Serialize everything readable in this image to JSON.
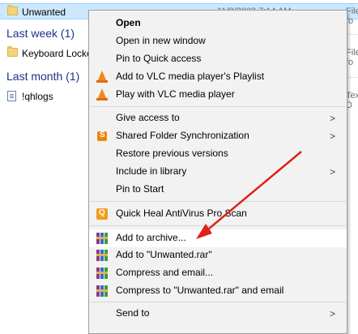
{
  "explorer": {
    "top_row": {
      "name": "Unwanted",
      "date": "11/8/2022 7:14 AM",
      "type": "File fo"
    },
    "groups": [
      {
        "label": "Last week (1)",
        "items": [
          {
            "name": "Keyboard Locke",
            "type": "File fo"
          }
        ]
      },
      {
        "label": "Last month (1)",
        "items": [
          {
            "name": "!qhlogs",
            "type": "Text D"
          }
        ]
      }
    ]
  },
  "context_menu": {
    "items": [
      {
        "label": "Open",
        "icon": ""
      },
      {
        "label": "Open in new window",
        "icon": ""
      },
      {
        "label": "Pin to Quick access",
        "icon": ""
      },
      {
        "label": "Add to VLC media player's Playlist",
        "icon": "vlc-cone-icon"
      },
      {
        "label": "Play with VLC media player",
        "icon": "vlc-cone-icon"
      },
      {
        "label": "Give access to",
        "icon": "",
        "submenu": true
      },
      {
        "label": "Shared Folder Synchronization",
        "icon": "shared-folder-sync-icon",
        "submenu": true
      },
      {
        "label": "Restore previous versions",
        "icon": ""
      },
      {
        "label": "Include in library",
        "icon": "",
        "submenu": true
      },
      {
        "label": "Pin to Start",
        "icon": ""
      },
      {
        "label": "Quick Heal AntiVirus Pro Scan",
        "icon": "quick-heal-icon"
      },
      {
        "label": "Add to archive...",
        "icon": "winrar-icon"
      },
      {
        "label": "Add to \"Unwanted.rar\"",
        "icon": "winrar-icon"
      },
      {
        "label": "Compress and email...",
        "icon": "winrar-icon"
      },
      {
        "label": "Compress to \"Unwanted.rar\" and email",
        "icon": "winrar-icon"
      },
      {
        "label": "Send to",
        "icon": "",
        "submenu": true
      }
    ],
    "highlighted": "Add to archive...",
    "submenu_arrow": ">"
  },
  "colors": {
    "selection": "#cce8ff",
    "group_header": "#1e3287",
    "menu_bg": "#f2f2f2",
    "arrow": "#e0201b"
  }
}
